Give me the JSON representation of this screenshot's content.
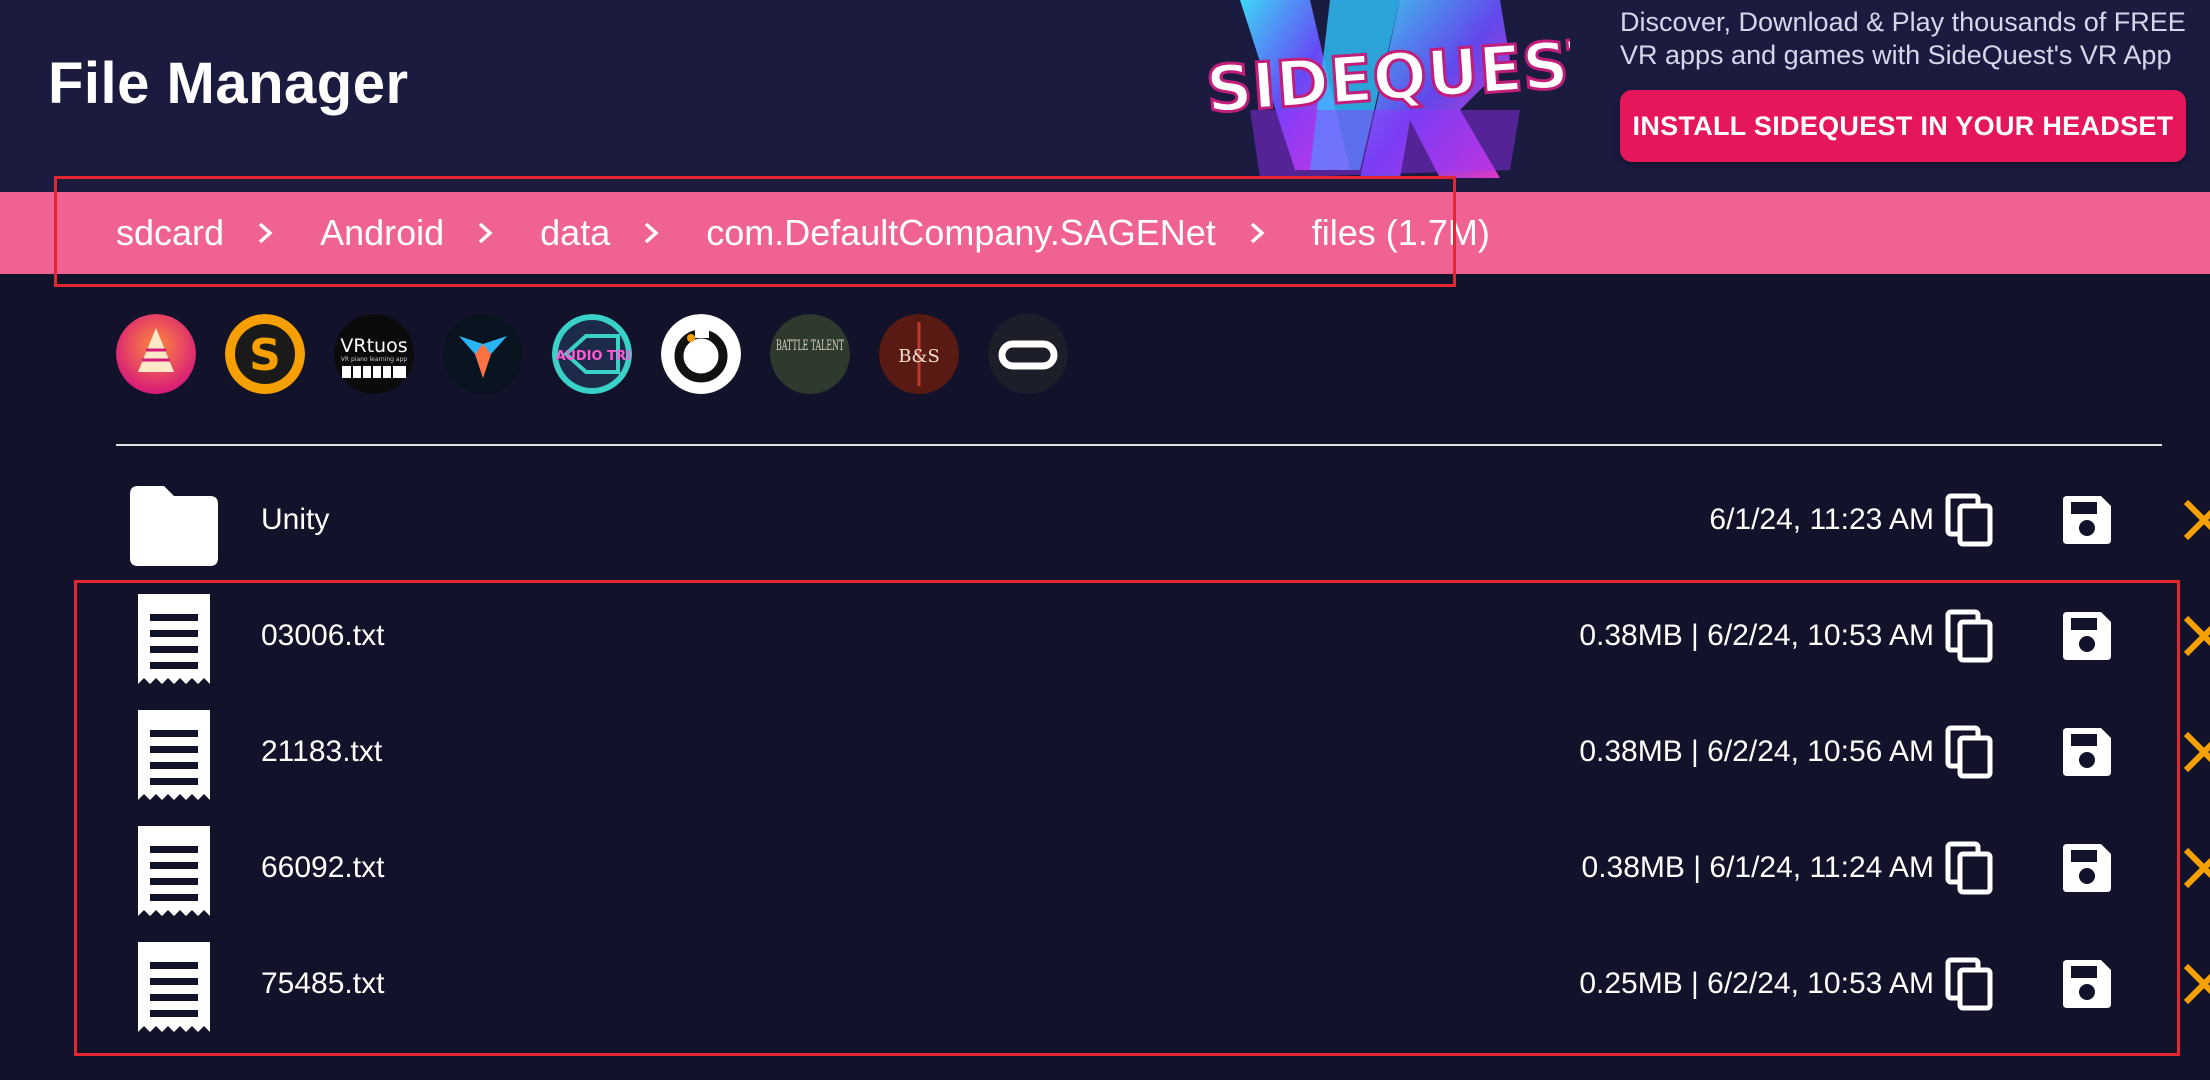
{
  "header": {
    "title": "File Manager",
    "promo_logo_text": "SIDEQUEST",
    "promo_text": "Discover, Download & Play thousands of FREE VR apps and games with SideQuest's VR App",
    "install_label": "INSTALL SIDEQUEST IN YOUR HEADSET"
  },
  "breadcrumb": [
    {
      "label": "sdcard"
    },
    {
      "label": "Android"
    },
    {
      "label": "data"
    },
    {
      "label": "com.DefaultCompany.SAGENet"
    },
    {
      "label": "files (1.7M)"
    }
  ],
  "app_icons": [
    {
      "name": "pyramid-app-icon"
    },
    {
      "name": "sidequest-s-app-icon"
    },
    {
      "name": "vrtuos-app-icon",
      "text": "VRtuos",
      "subtext": "VR piano learning app"
    },
    {
      "name": "winged-logo-app-icon"
    },
    {
      "name": "audio-trip-app-icon",
      "text": "AUDIO TRIP"
    },
    {
      "name": "ring-app-icon"
    },
    {
      "name": "battle-talent-app-icon",
      "text": "BATTLE TALENT"
    },
    {
      "name": "blade-sorcery-app-icon",
      "text": "B&S"
    },
    {
      "name": "oculus-app-icon"
    }
  ],
  "files": [
    {
      "type": "folder",
      "name": "Unity",
      "meta": "6/1/24, 11:23 AM"
    },
    {
      "type": "file",
      "name": "03006.txt",
      "meta": "0.38MB | 6/2/24, 10:53 AM"
    },
    {
      "type": "file",
      "name": "21183.txt",
      "meta": "0.38MB | 6/2/24, 10:56 AM"
    },
    {
      "type": "file",
      "name": "66092.txt",
      "meta": "0.38MB | 6/1/24, 11:24 AM"
    },
    {
      "type": "file",
      "name": "75485.txt",
      "meta": "0.25MB | 6/2/24, 10:53 AM"
    }
  ],
  "colors": {
    "background": "#12122a",
    "header": "#1b1b40",
    "breadcrumb_bar": "#f06292",
    "install_button": "#e5175a",
    "delete_icon": "#f5a000",
    "highlight_border": "#e3262f"
  }
}
